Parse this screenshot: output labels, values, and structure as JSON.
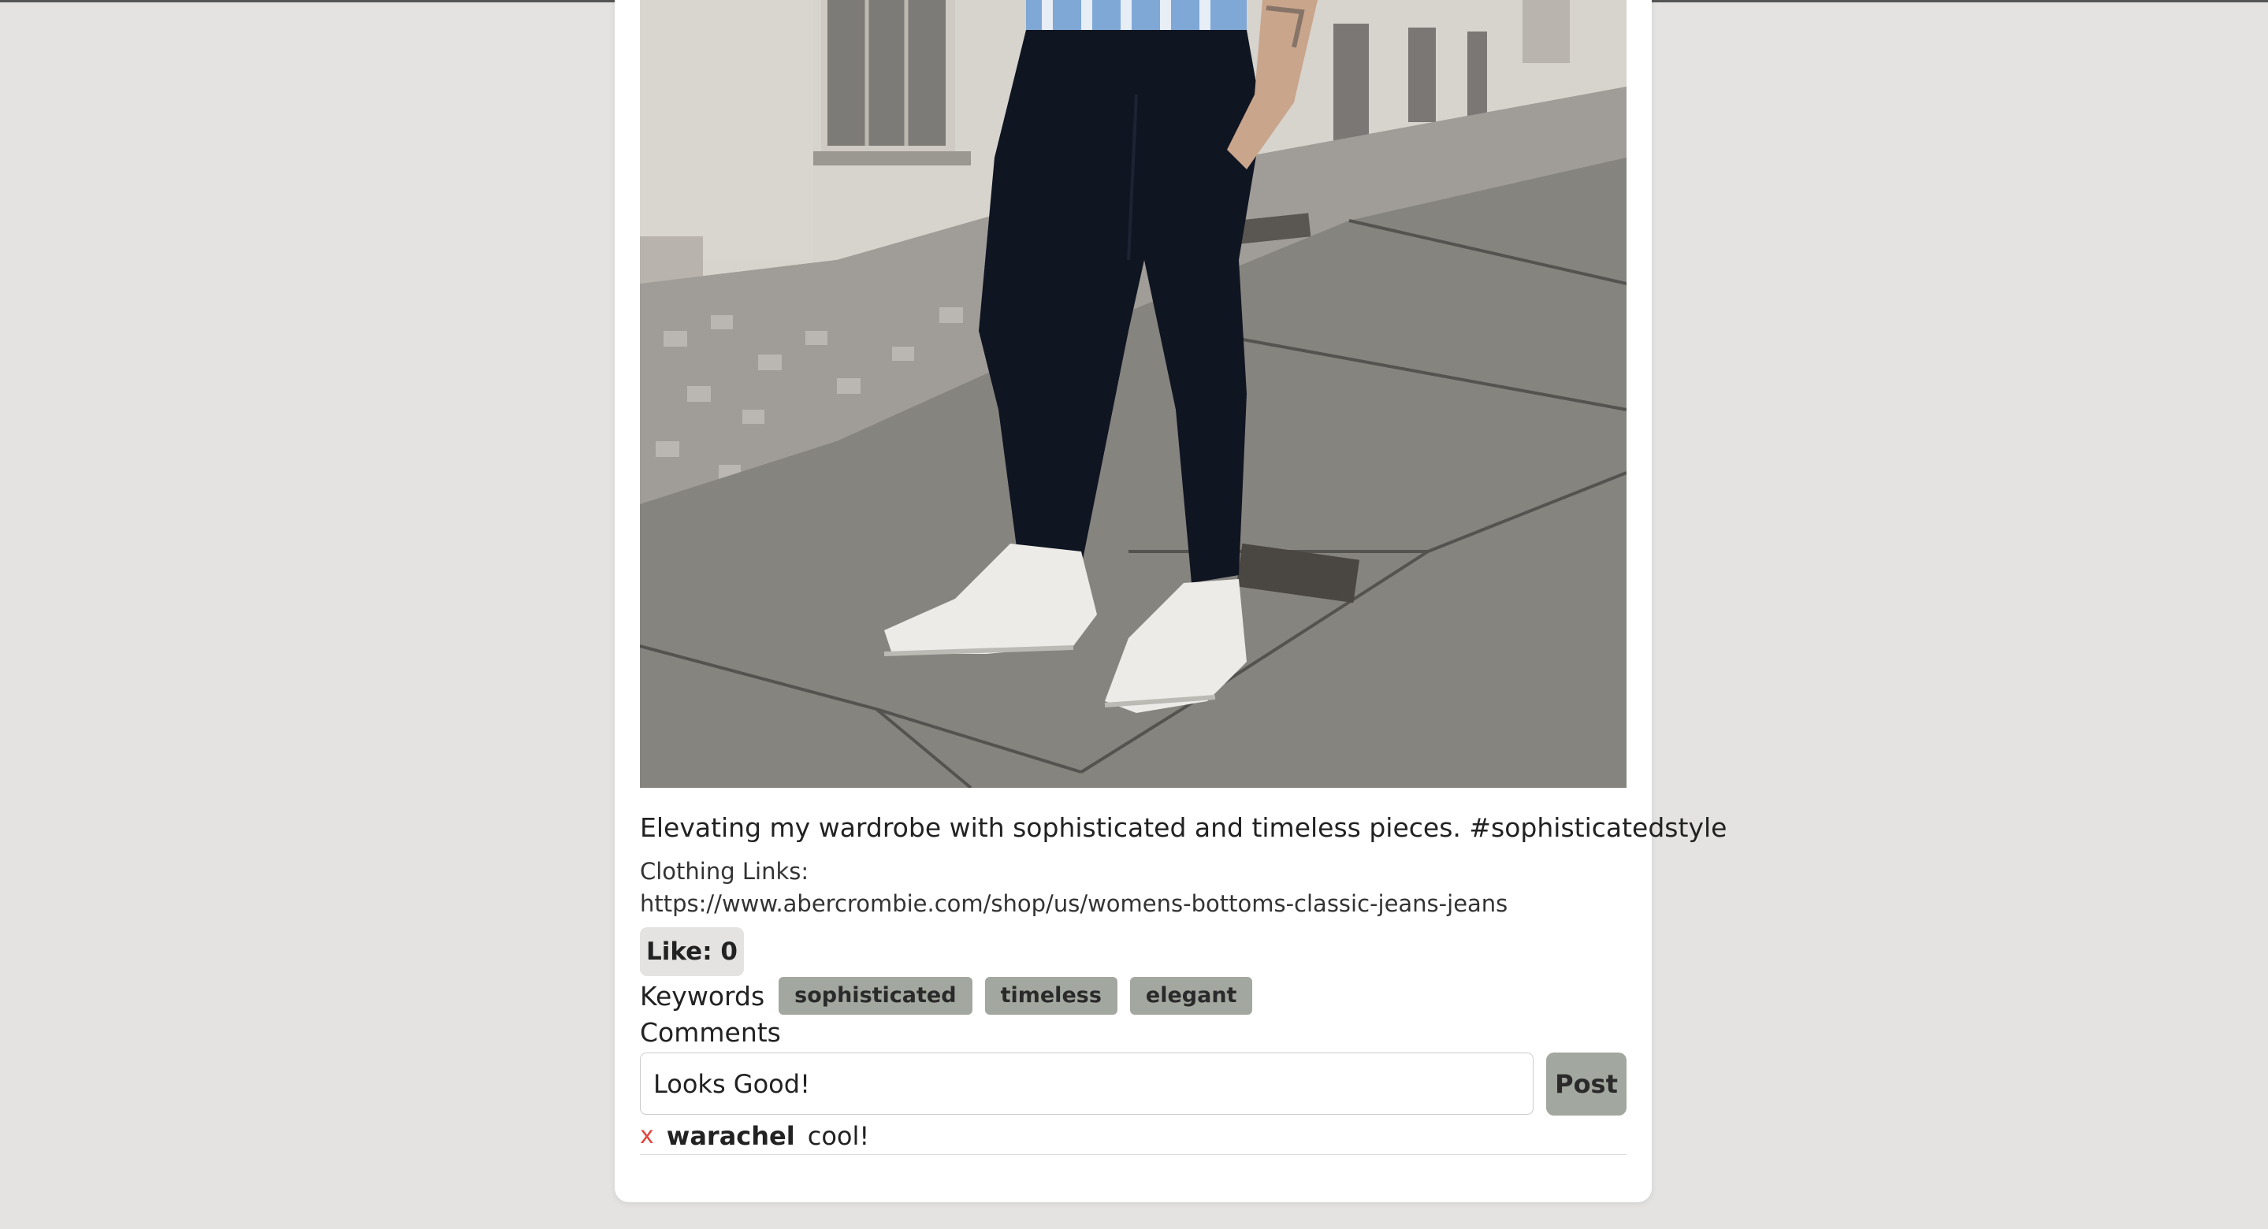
{
  "post": {
    "image_alt": "Person wearing navy jogger pants and white sneakers on a stone sidewalk",
    "caption": "Elevating my wardrobe with sophisticated and timeless pieces. #sophisticatedstyle",
    "clothing_links_label": "Clothing Links:",
    "clothing_links_url": "https://www.abercrombie.com/shop/us/womens-bottoms-classic-jeans-jeans",
    "like_label": "Like: ",
    "like_count": "0",
    "keywords_label": "Keywords",
    "keywords": [
      "sophisticated",
      "timeless",
      "elegant"
    ],
    "comments_label": "Comments",
    "comment_input_value": "Looks Good!",
    "post_button_label": "Post",
    "comments": [
      {
        "delete_label": "x",
        "user": "warachel",
        "text": "cool!"
      }
    ]
  },
  "colors": {
    "page_background": "#e4e3e1",
    "card_background": "#ffffff",
    "tag_background": "#a2a79f",
    "delete_color": "#e0463d"
  }
}
